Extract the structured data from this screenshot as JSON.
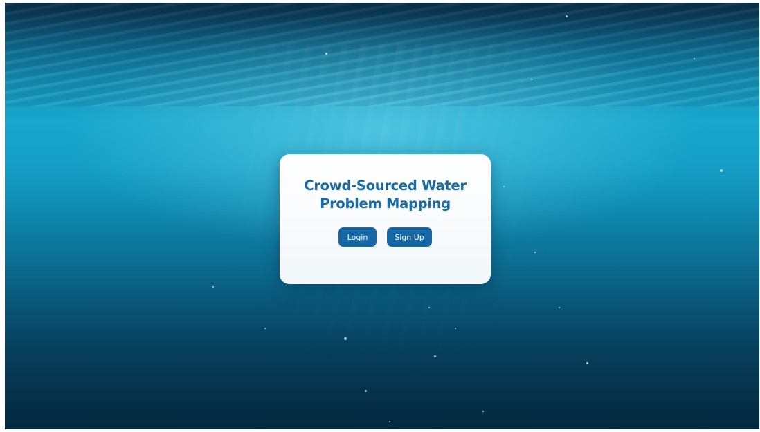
{
  "page": {
    "title_line_1": "Crowd-Sourced Water",
    "title_line_2": "Problem Mapping"
  },
  "actions": {
    "login_label": "Login",
    "signup_label": "Sign Up"
  },
  "colors": {
    "accent": "#1667a6",
    "title": "#1a6aa3",
    "card_background": "#ffffff",
    "background_water": "#18a6cc"
  }
}
